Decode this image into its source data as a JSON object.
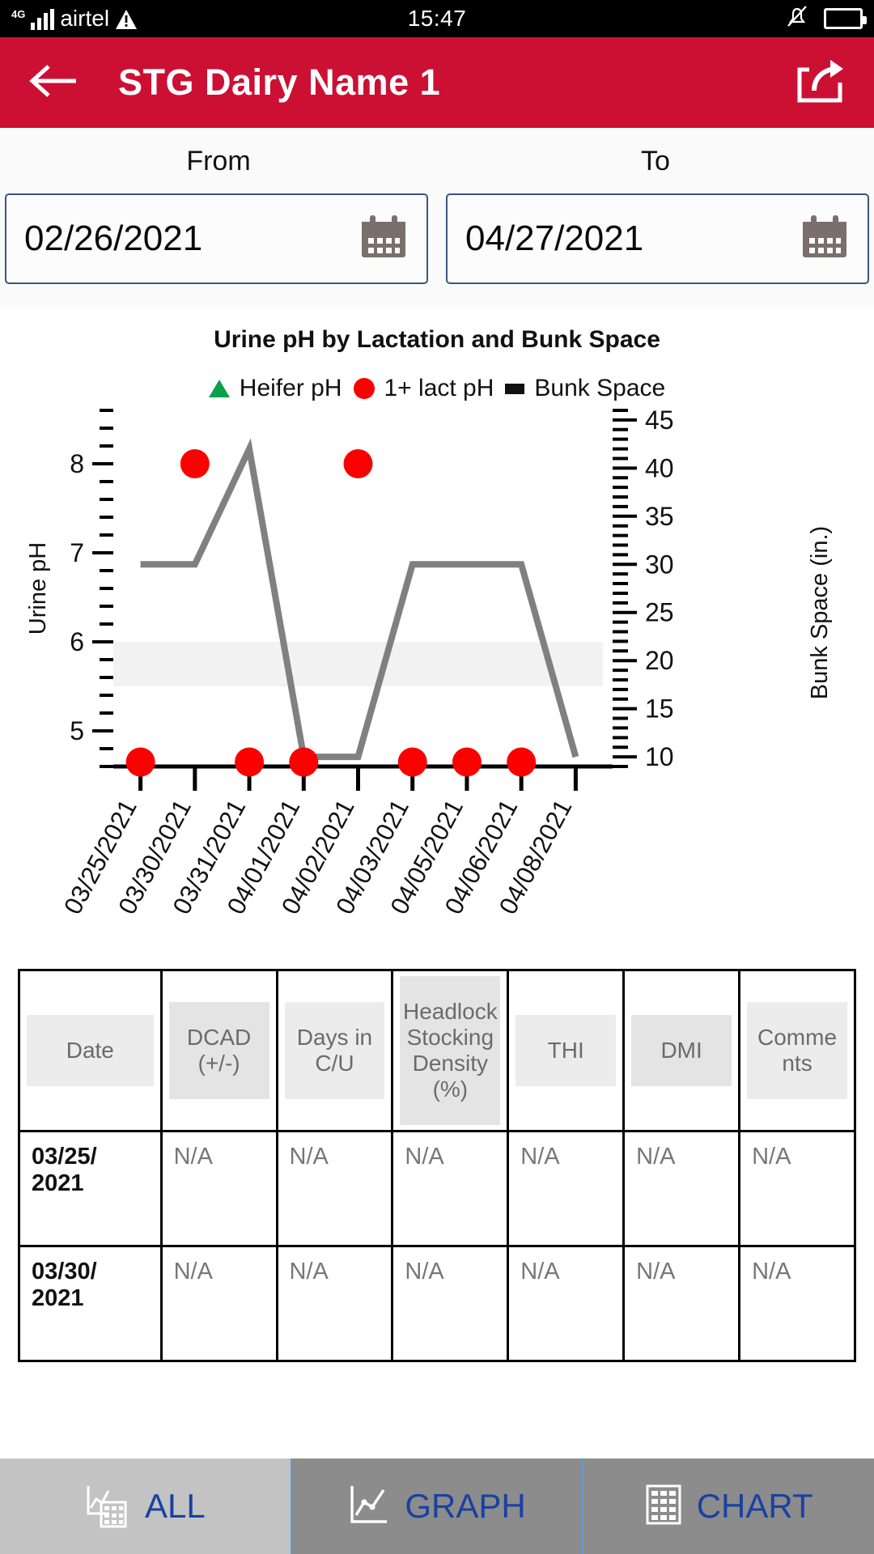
{
  "status_bar": {
    "network": "4G",
    "carrier": "airtel",
    "warning_icon": "warning-triangle-icon",
    "clock": "15:47",
    "bell_icon": "bell-off-icon",
    "battery_icon": "battery-half-icon"
  },
  "app_bar": {
    "back_icon": "back-arrow-icon",
    "title": "STG Dairy Name 1",
    "share_icon": "share-icon",
    "accent": "#CC1034"
  },
  "date_range": {
    "from_label": "From",
    "to_label": "To",
    "from_value": "02/26/2021",
    "to_value": "04/27/2021",
    "from_placeholder": "MM/DD/YYYY",
    "to_placeholder": "MM/DD/YYYY",
    "calendar_icon": "calendar-icon"
  },
  "chart_data": {
    "type": "line",
    "title": "Urine pH by Lactation and Bunk Space",
    "xlabel": "",
    "ylabel": "Urine pH",
    "y2label": "Bunk Space (in.)",
    "grid": false,
    "legend_position": "top",
    "ylim": [
      4.6,
      8.6
    ],
    "y2lim": [
      9,
      46
    ],
    "yticks": [
      5,
      6,
      7,
      8
    ],
    "y2ticks": [
      10,
      15,
      20,
      25,
      30,
      35,
      40,
      45
    ],
    "y_minor_step": 0.2,
    "y2_minor_step": 1,
    "shaded_band": {
      "from": 5.5,
      "to": 6.0,
      "color": "#f2f2f2"
    },
    "categories": [
      "03/25/2021",
      "03/30/2021",
      "03/31/2021",
      "04/01/2021",
      "04/02/2021",
      "04/03/2021",
      "04/05/2021",
      "04/06/2021",
      "04/08/2021"
    ],
    "series": [
      {
        "name": "Heifer pH",
        "marker": "triangle",
        "color": "#0aa04b",
        "axis": "left",
        "values": [
          null,
          null,
          null,
          null,
          null,
          null,
          null,
          null,
          null
        ]
      },
      {
        "name": "1+ lact pH",
        "marker": "circle",
        "color": "#fc0000",
        "axis": "left",
        "values": [
          4.65,
          8.0,
          4.65,
          4.65,
          8.0,
          4.65,
          4.65,
          4.65,
          null
        ]
      },
      {
        "name": "Bunk Space",
        "marker": "square",
        "color": "#808080",
        "axis": "right",
        "values": [
          30,
          30,
          42,
          10,
          10,
          30,
          30,
          30,
          10
        ]
      }
    ],
    "legend": [
      {
        "label": "Heifer pH",
        "marker": "triangle",
        "color": "#0aa04b"
      },
      {
        "label": "1+ lact pH",
        "marker": "circle",
        "color": "#fc0000"
      },
      {
        "label": "Bunk Space",
        "marker": "square",
        "color": "#111111"
      }
    ]
  },
  "table": {
    "headers": [
      "Date",
      "DCAD (+/-)",
      "Days in C/U",
      "Headlock Stocking Density (%)",
      "THI",
      "DMI",
      "Comments"
    ],
    "header_lines": [
      [
        "Date"
      ],
      [
        "DCAD",
        "(+/-)"
      ],
      [
        "Days in",
        "C/U"
      ],
      [
        "Headlock",
        "Stocking",
        "Density",
        "(%)"
      ],
      [
        "THI"
      ],
      [
        "DMI"
      ],
      [
        "Comme",
        "nts"
      ]
    ],
    "rows": [
      {
        "date": "03/25/ 2021",
        "values": [
          "N/A",
          "N/A",
          "N/A",
          "N/A",
          "N/A",
          "N/A"
        ]
      },
      {
        "date": "03/30/ 2021",
        "values": [
          "N/A",
          "N/A",
          "N/A",
          "N/A",
          "N/A",
          "N/A"
        ]
      }
    ]
  },
  "tabs": [
    {
      "label": "ALL",
      "icon": "chart-table-icon",
      "selected": true
    },
    {
      "label": "GRAPH",
      "icon": "line-chart-icon",
      "selected": false
    },
    {
      "label": "CHART",
      "icon": "table-grid-icon",
      "selected": false
    }
  ]
}
